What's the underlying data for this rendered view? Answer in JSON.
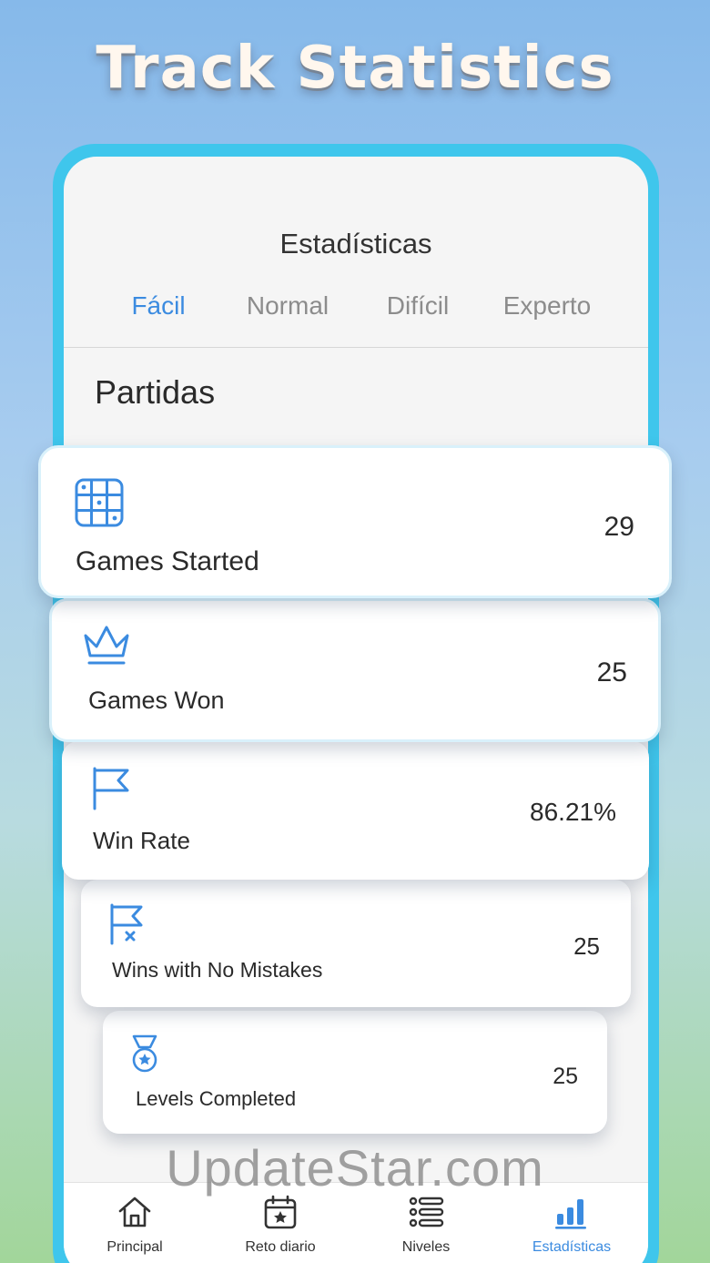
{
  "promo": {
    "headline": "Track Statistics"
  },
  "screen": {
    "title": "Estadísticas",
    "tabs": [
      {
        "label": "Fácil",
        "active": true
      },
      {
        "label": "Normal",
        "active": false
      },
      {
        "label": "Difícil",
        "active": false
      },
      {
        "label": "Experto",
        "active": false
      }
    ],
    "section_title": "Partidas"
  },
  "stats": [
    {
      "label": "Games Started",
      "value": "29",
      "icon": "grid-icon"
    },
    {
      "label": "Games Won",
      "value": "25",
      "icon": "crown-icon"
    },
    {
      "label": "Win Rate",
      "value": "86.21%",
      "icon": "flag-icon"
    },
    {
      "label": "Wins with No Mistakes",
      "value": "25",
      "icon": "flag-x-icon"
    },
    {
      "label": "Levels Completed",
      "value": "25",
      "icon": "medal-icon"
    }
  ],
  "bottom_nav": [
    {
      "label": "Principal",
      "icon": "home-icon",
      "active": false
    },
    {
      "label": "Reto diario",
      "icon": "calendar-star-icon",
      "active": false
    },
    {
      "label": "Niveles",
      "icon": "list-icon",
      "active": false
    },
    {
      "label": "Estadísticas",
      "icon": "bar-chart-icon",
      "active": true
    }
  ],
  "watermark": "UpdateStar.com",
  "colors": {
    "accent": "#3b8be0",
    "frame": "#3fc6ec",
    "text": "#2a2a2a",
    "muted": "#8c8c8c"
  }
}
